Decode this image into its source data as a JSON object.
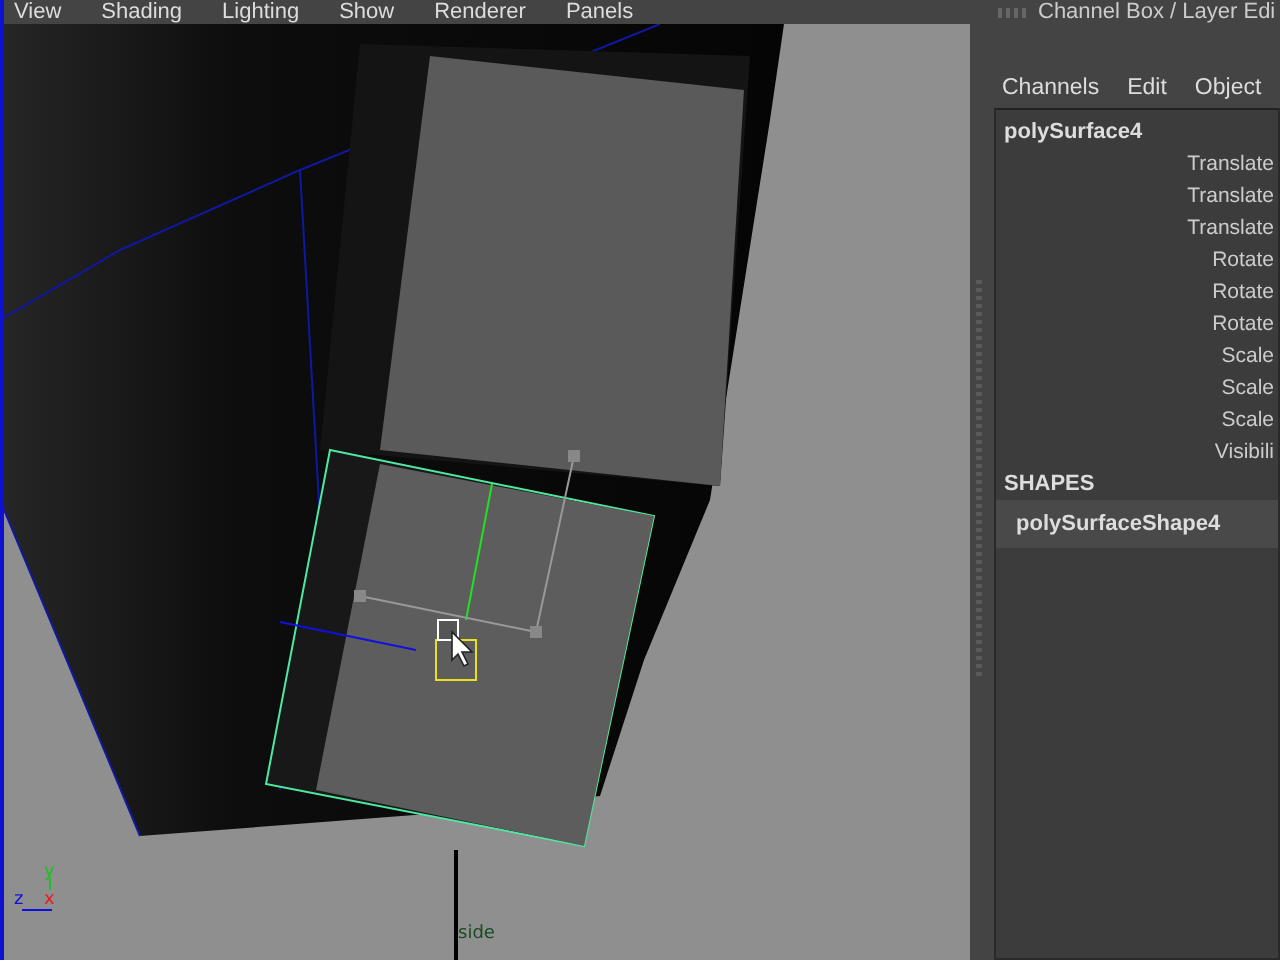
{
  "menu": [
    "View",
    "Shading",
    "Lighting",
    "Show",
    "Renderer",
    "Panels"
  ],
  "viewport": {
    "camera_label": "side",
    "axis_labels": {
      "y": "y",
      "z": "z",
      "x": "x"
    }
  },
  "channel_box": {
    "title": "Channel Box / Layer Edi",
    "menu": [
      "Channels",
      "Edit",
      "Object"
    ],
    "object": "polySurface4",
    "attributes": [
      "Translate",
      "Translate",
      "Translate",
      "Rotate",
      "Rotate",
      "Rotate",
      "Scale",
      "Scale",
      "Scale",
      "Visibili"
    ],
    "shapes_heading": "SHAPES",
    "shapes": [
      {
        "name": "polySurfaceShape4",
        "selected": true
      }
    ]
  }
}
